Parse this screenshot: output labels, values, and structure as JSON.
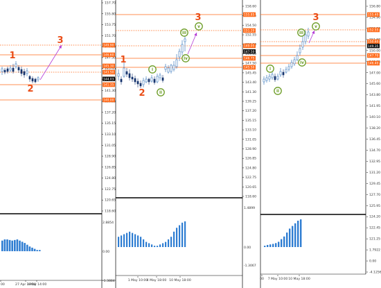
{
  "colors": {
    "bull": "#1f66b5",
    "bear": "#17356e",
    "indicator": "#2e7dd2",
    "level": "#ff6a1a",
    "wave_main": "#ea4d17",
    "wave_sub": "#6a9b22",
    "arrow": "#b33ad6",
    "axis_text": "#333333",
    "price_box": "#111111"
  },
  "charts": [
    {
      "name": "chart-1",
      "price_axis": [
        "157.70",
        "155.80",
        "153.75",
        "151.70",
        "149.55",
        "147.50",
        "145.45",
        "143.40",
        "141.30",
        "139.25",
        "137.20",
        "135.15",
        "133.10",
        "131.05",
        "128.90",
        "126.85",
        "124.80",
        "122.75",
        "120.65",
        "118.60"
      ],
      "level_tags": [
        "149.90",
        "146.60",
        "145.30",
        "143.50",
        "141.35",
        "140.00"
      ],
      "current_price": "144.03",
      "time_axis": [
        "00",
        "27 Apr 18:00",
        "3 May 14:00"
      ],
      "indicator_axis": [
        "2.8854",
        "0.00",
        "-1.3884"
      ],
      "waves": [
        "1",
        "2",
        "3"
      ],
      "indicator_values": [
        0.9,
        1.0,
        1.0,
        0.95,
        0.9,
        0.95,
        1.0,
        0.9,
        0.8,
        0.7,
        0.55,
        0.4,
        0.3,
        0.2,
        0.1,
        0.1
      ]
    },
    {
      "name": "chart-2",
      "price_axis": [
        "158.60",
        "156.65",
        "154.50",
        "152.55",
        "150.60",
        "149.00",
        "147.50",
        "145.45",
        "143.40",
        "141.30",
        "139.25",
        "137.20",
        "135.15",
        "133.10",
        "131.05",
        "128.90",
        "126.85",
        "124.80",
        "122.75",
        "120.65",
        "118.60"
      ],
      "level_tags": [
        "155.85",
        "151.20",
        "149.05",
        "146.75",
        "145.50"
      ],
      "current_price": "147.50",
      "time_axis": [
        "1 May 10:00",
        "4 May 18:00",
        "10 May 18:00"
      ],
      "indicator_axis": [
        "1.4899",
        "0.00",
        "-1.3067"
      ],
      "waves": [
        "1",
        "2",
        "3",
        "i",
        "ii",
        "iii",
        "iv",
        "v"
      ],
      "indicator_values": [
        0.4,
        0.45,
        0.5,
        0.55,
        0.6,
        0.55,
        0.5,
        0.45,
        0.4,
        0.3,
        0.2,
        0.15,
        0.1,
        0.05,
        0.05,
        0.1,
        0.15,
        0.2,
        0.3,
        0.4,
        0.6,
        0.75,
        0.85,
        0.95,
        1.0
      ]
    },
    {
      "name": "chart-3",
      "price_axis": [
        "156.80",
        "154.90",
        "153.20",
        "151.60",
        "150.00",
        "148.35",
        "147.00",
        "145.60",
        "143.80",
        "141.95",
        "140.10",
        "138.20",
        "136.45",
        "134.70",
        "132.95",
        "131.20",
        "129.45",
        "127.70",
        "125.95",
        "124.20",
        "122.45",
        "121.25",
        "1.7922",
        "0.00",
        "-4.1256"
      ],
      "level_tags": [
        "155.40",
        "152.55",
        "150.60",
        "149.35",
        "147.70",
        "146.40"
      ],
      "current_price": "149.35",
      "time_axis": [
        "00",
        "7 May 10:00",
        "10 May 18:00"
      ],
      "waves": [
        "3",
        "i",
        "ii",
        "iii",
        "iv",
        "v"
      ],
      "indicator_values": [
        0.05,
        0.08,
        0.1,
        0.12,
        0.15,
        0.2,
        0.3,
        0.4,
        0.55,
        0.7,
        0.8,
        0.9,
        1.0,
        1.05
      ]
    }
  ]
}
